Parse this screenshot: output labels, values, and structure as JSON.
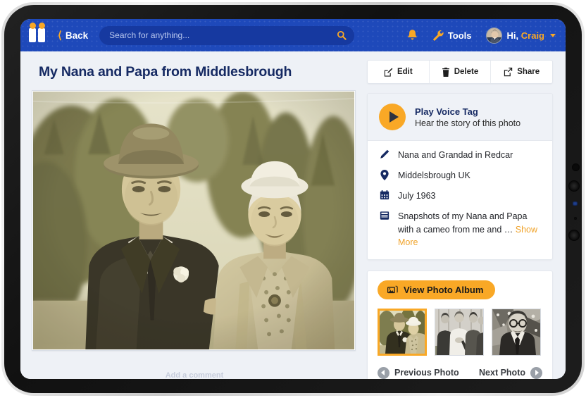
{
  "header": {
    "logo_name": "app-logo",
    "back_label": "Back",
    "search": {
      "placeholder": "Search for anything...",
      "value": "",
      "icon": "search-icon"
    },
    "notifications_icon": "bell-icon",
    "tools_label": "Tools",
    "tools_icon": "wrench-icon",
    "greeting_prefix": "Hi,",
    "user_name": "Craig",
    "avatar_name": "user-avatar"
  },
  "main": {
    "page_title": "My Nana and Papa from Middlesbrough",
    "photo_alt": "Vintage sepia photograph of an elderly couple outdoors",
    "bottom_peek_text": "Add a comment"
  },
  "actions": [
    {
      "label": "Edit",
      "icon": "pencil-square-icon"
    },
    {
      "label": "Delete",
      "icon": "trash-icon"
    },
    {
      "label": "Share",
      "icon": "share-icon"
    }
  ],
  "voice_tag": {
    "title": "Play Voice Tag",
    "subtitle": "Hear the story of this photo",
    "play_icon": "play-icon"
  },
  "metadata": [
    {
      "icon": "pencil-icon",
      "text": "Nana and Grandad in Redcar"
    },
    {
      "icon": "location-pin-icon",
      "text": "Middelsbrough UK"
    },
    {
      "icon": "calendar-icon",
      "text": "July 1963"
    }
  ],
  "description": {
    "icon": "book-icon",
    "text": "Snapshots of my Nana and Papa with a cameo from me and …",
    "show_more_label": "Show More"
  },
  "album": {
    "button_label": "View Photo Album",
    "button_icon": "photos-icon",
    "thumbnails": [
      {
        "name": "thumbnail-1",
        "selected": true,
        "alt": "Couple standing outdoors in sepia"
      },
      {
        "name": "thumbnail-2",
        "selected": false,
        "alt": "Group of four women in coats"
      },
      {
        "name": "thumbnail-3",
        "selected": false,
        "alt": "Man with glasses in suit at party"
      }
    ],
    "previous_label": "Previous Photo",
    "next_label": "Next Photo"
  },
  "colors": {
    "header_blue": "#1e49ba",
    "search_blue": "#1639a0",
    "accent_orange": "#f9a826",
    "title_navy": "#162a63",
    "page_bg": "#eef1f6",
    "card_bg": "#ffffff"
  }
}
